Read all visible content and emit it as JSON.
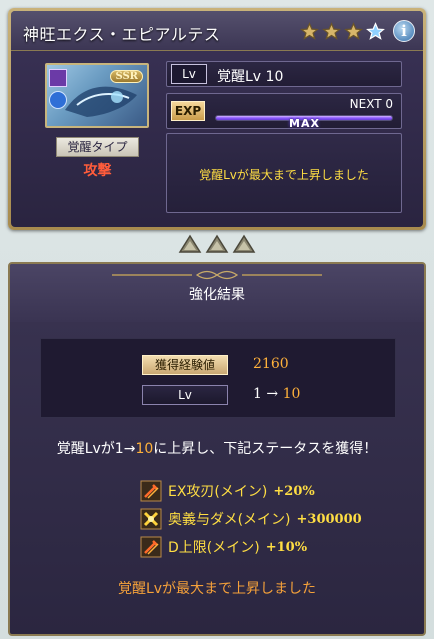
{
  "character": {
    "name": "神旺エクス・エピアルテス",
    "rarity_badge": "SSR",
    "stars_filled": 3,
    "stars_total": 4
  },
  "awakening": {
    "type_label": "覚醒タイプ",
    "type_value": "攻撃",
    "lv_tag": "Lv",
    "lv_text": "覚醒Lv 10",
    "exp_tag": "EXP",
    "next_text": "NEXT 0",
    "exp_fill_fraction": 1.0,
    "max_label": "MAX",
    "message": "覚醒Lvが最大まで上昇しました"
  },
  "result": {
    "title": "強化結果",
    "gained_exp_label": "獲得経験値",
    "gained_exp_value": "2160",
    "lv_label": "Lv",
    "lv_from": "1",
    "lv_arrow": "→",
    "lv_to": "10",
    "summary_prefix": "覚醒Lvが",
    "summary_from": "1",
    "summary_arrow": "→",
    "summary_to": "10",
    "summary_suffix": "に上昇し、下記ステータスを獲得！",
    "bonuses": [
      {
        "icon": "attack-up-icon",
        "name": "EX攻刃(メイン)",
        "value": "+20%"
      },
      {
        "icon": "ougi-damage-icon",
        "name": "奥義与ダメ(メイン)",
        "value": "+300000"
      },
      {
        "icon": "attack-up-icon",
        "name": "D上限(メイン)",
        "value": "+10%"
      }
    ],
    "footer_message": "覚醒Lvが最大まで上昇しました"
  },
  "colors": {
    "accent_gold": "#ffde43",
    "accent_orange": "#ffb13b",
    "type_red": "#ff5c3b",
    "exp_bar_purple": "#8c5bff"
  }
}
